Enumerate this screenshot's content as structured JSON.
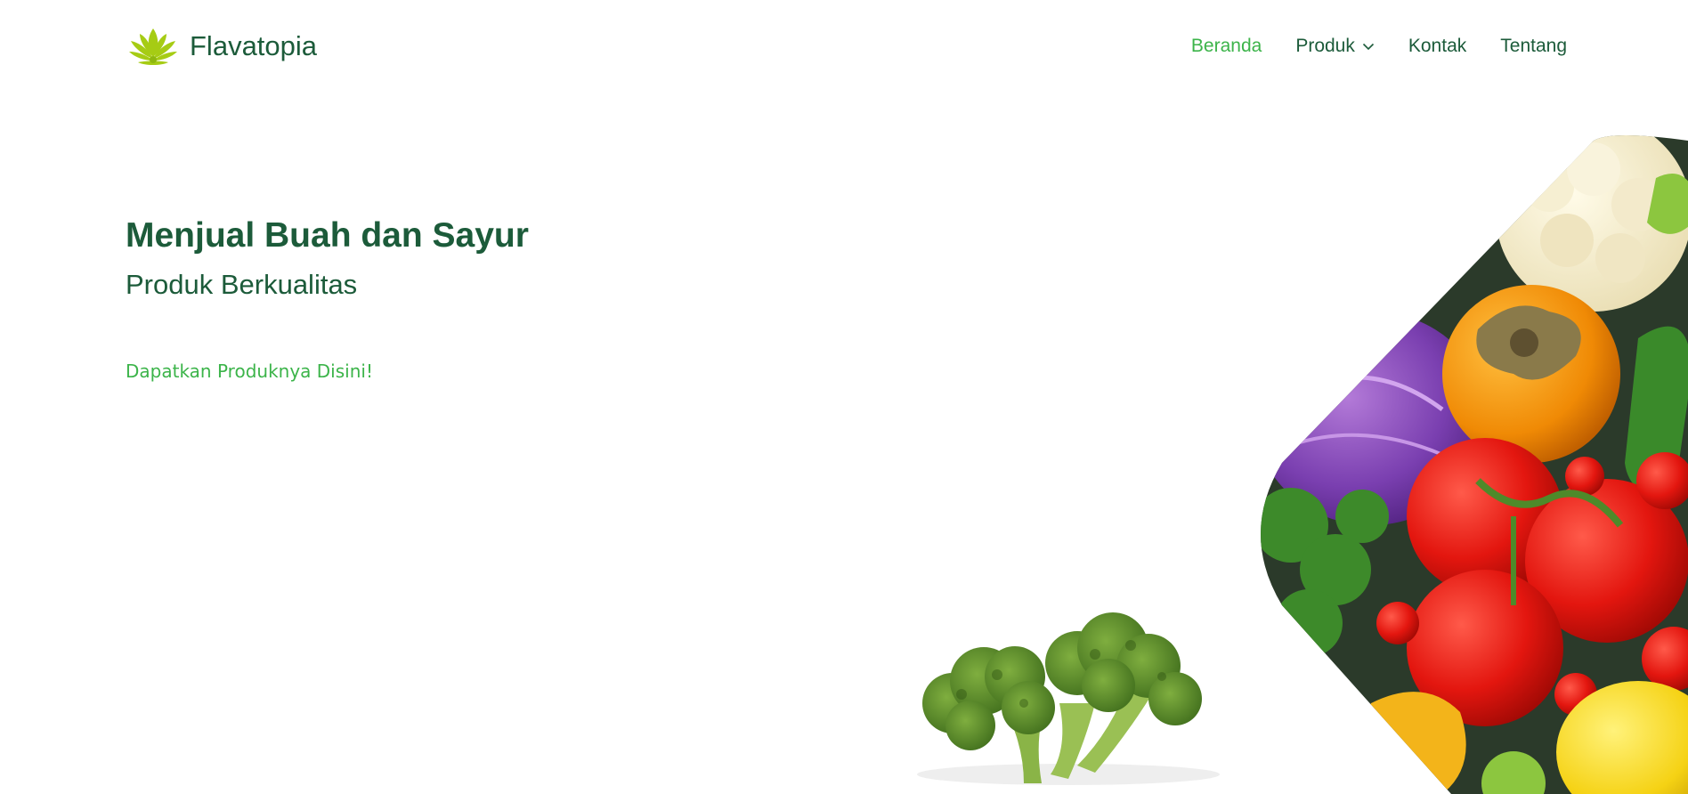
{
  "brand": {
    "name": "Flavatopia",
    "logo_icon": "lotus-icon",
    "accent": "#a6cc14"
  },
  "nav": {
    "items": [
      {
        "label": "Beranda",
        "active": true
      },
      {
        "label": "Produk",
        "has_dropdown": true,
        "icon": "chevron-down-icon"
      },
      {
        "label": "Kontak"
      },
      {
        "label": "Tentang"
      }
    ]
  },
  "hero": {
    "title": "Menjual Buah dan Sayur",
    "subtitle": "Produk Berkualitas",
    "cta": "Dapatkan Produknya Disini!"
  },
  "colors": {
    "primary_text": "#1c5b3a",
    "active_green": "#3cb44a",
    "background": "#ffffff"
  },
  "images": [
    {
      "name": "vegetables-collage-image",
      "depicts": "fresh fruits and vegetables"
    },
    {
      "name": "broccoli-image",
      "depicts": "broccoli"
    }
  ]
}
